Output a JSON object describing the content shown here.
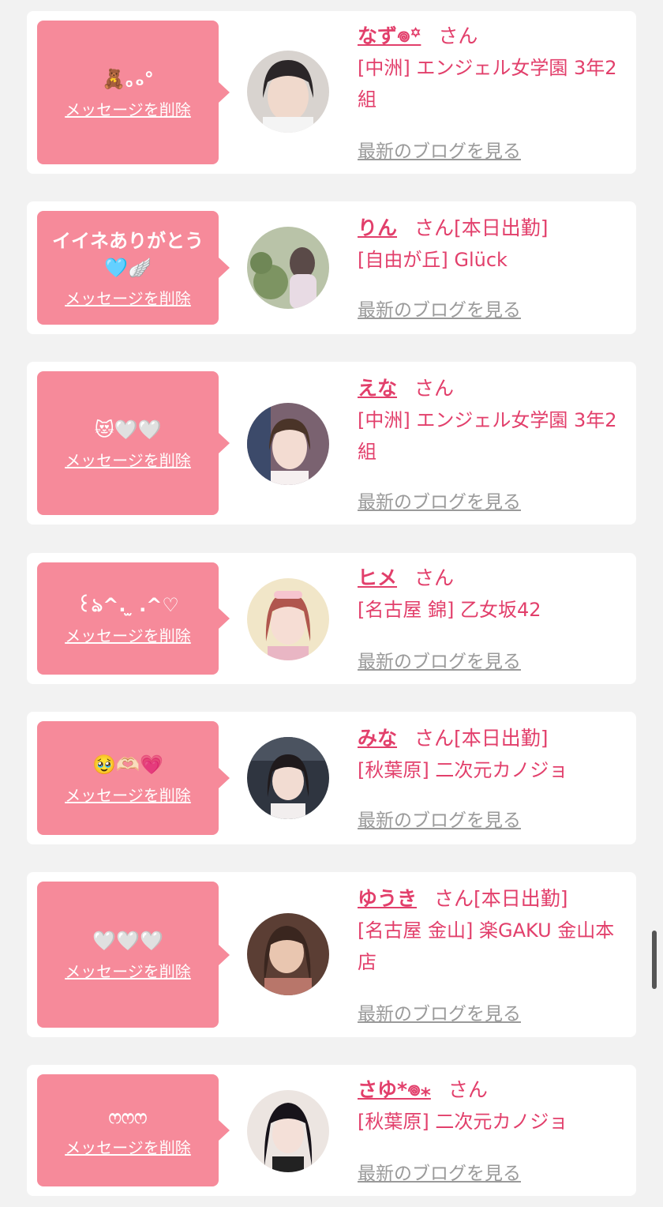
{
  "common": {
    "delete_label": "メッセージを削除",
    "san_label": "さん",
    "blog_label": "最新のブログを見る"
  },
  "colors": {
    "bubble": "#f68a9a",
    "accent": "#e23f6b",
    "link_gray": "#9a9a9a",
    "background": "#f2f2f2"
  },
  "items": [
    {
      "message": "🧸｡ₒ°",
      "name": "なず𖦹꙳",
      "status": "",
      "shop": "[中洲] エンジェル女学園 3年2組",
      "avatar_tone": "#c9c4c0"
    },
    {
      "message": "イイネありがとう🩵🪽",
      "name": "りん",
      "status": "[本日出勤]",
      "shop": "[自由が丘] Glück",
      "avatar_tone": "#9fae8a"
    },
    {
      "message": "😻🤍🤍",
      "name": "えな",
      "status": "",
      "shop": "[中洲] エンジェル女学園 3年2組",
      "avatar_tone": "#8b6f7c"
    },
    {
      "message": "꒰ঌ^. ̫ .^♡",
      "name": "ヒメ",
      "status": "",
      "shop": "[名古屋 錦] 乙女坂42",
      "avatar_tone": "#e4c7b6"
    },
    {
      "message": "🥹🫶🏻💗",
      "name": "みな",
      "status": "[本日出勤]",
      "shop": "[秋葉原] 二次元カノジョ",
      "avatar_tone": "#3b3f46"
    },
    {
      "message": "🤍🤍🤍",
      "name": "ゆうき",
      "status": "[本日出勤]",
      "shop": "[名古屋 金山] 楽GAKU 金山本店",
      "avatar_tone": "#6b4a3c"
    },
    {
      "message": "ෆෆෆ",
      "name": "さゆ*𖦹⁎",
      "status": "",
      "shop": "[秋葉原] 二次元カノジョ",
      "avatar_tone": "#e6ddd8"
    }
  ]
}
